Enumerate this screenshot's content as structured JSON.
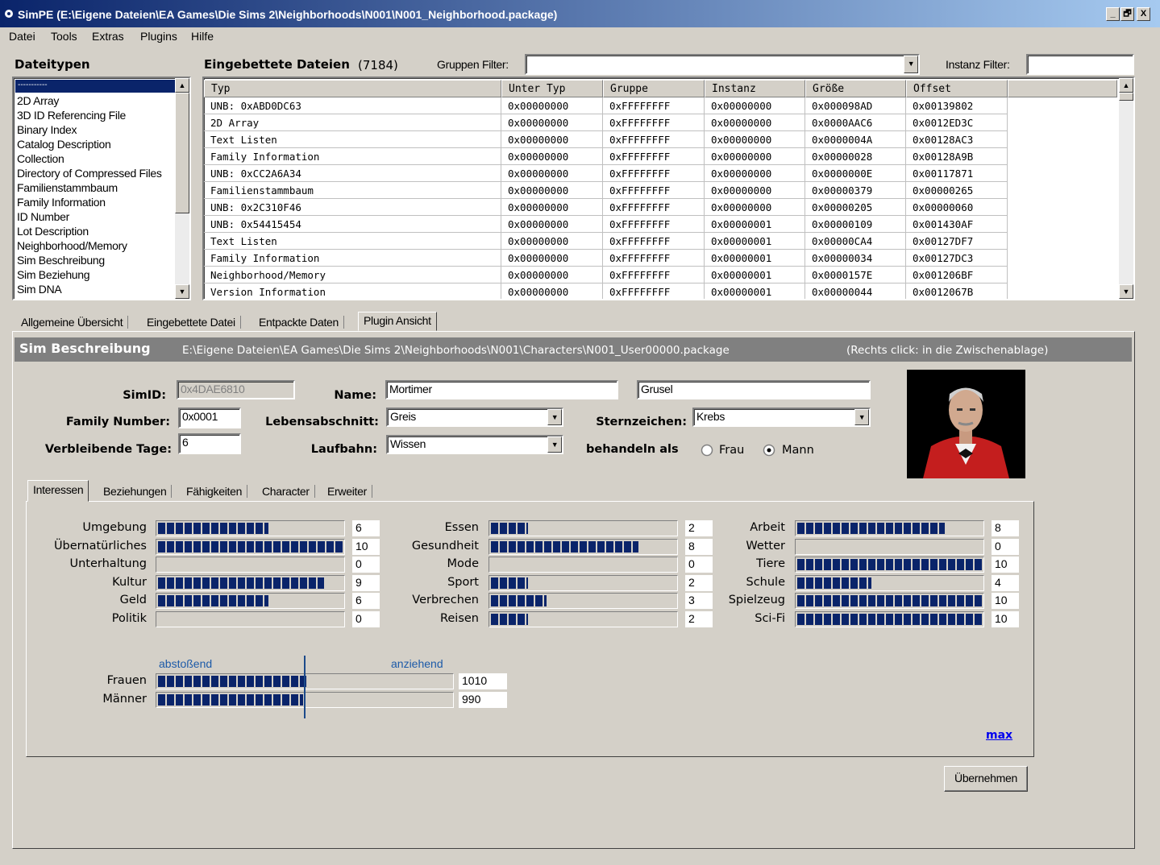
{
  "window": {
    "title": "SimPE (E:\\Eigene Dateien\\EA Games\\Die Sims 2\\Neighborhoods\\N001\\N001_Neighborhood.package)",
    "buttons": [
      "_",
      "🗗",
      "X"
    ]
  },
  "menu": [
    "Datei",
    "Tools",
    "Extras",
    "Plugins",
    "Hilfe"
  ],
  "filetypes": {
    "header": "Dateitypen",
    "selected": "-----------",
    "items": [
      "2D Array",
      "3D ID Referencing File",
      "Binary Index",
      "Catalog Description",
      "Collection",
      "Directory of Compressed Files",
      "Familienstammbaum",
      "Family Information",
      "ID Number",
      "Lot Description",
      "Neighborhood/Memory",
      "Sim Beschreibung",
      "Sim Beziehung",
      "Sim DNA"
    ]
  },
  "embedded": {
    "header": "Eingebettete Dateien",
    "count": "(7184)",
    "group_filter_label": "Gruppen Filter:",
    "group_filter_value": "",
    "instance_filter_label": "Instanz Filter:",
    "instance_filter_value": "",
    "columns": [
      "Typ",
      "Unter Typ",
      "Gruppe",
      "Instanz",
      "Größe",
      "Offset"
    ],
    "rows": [
      [
        "UNB: 0xABD0DC63",
        "0x00000000",
        "0xFFFFFFFF",
        "0x00000000",
        "0x000098AD",
        "0x00139802"
      ],
      [
        "2D Array",
        "0x00000000",
        "0xFFFFFFFF",
        "0x00000000",
        "0x0000AAC6",
        "0x0012ED3C"
      ],
      [
        "Text Listen",
        "0x00000000",
        "0xFFFFFFFF",
        "0x00000000",
        "0x0000004A",
        "0x00128AC3"
      ],
      [
        "Family Information",
        "0x00000000",
        "0xFFFFFFFF",
        "0x00000000",
        "0x00000028",
        "0x00128A9B"
      ],
      [
        "UNB: 0xCC2A6A34",
        "0x00000000",
        "0xFFFFFFFF",
        "0x00000000",
        "0x0000000E",
        "0x00117871"
      ],
      [
        "Familienstammbaum",
        "0x00000000",
        "0xFFFFFFFF",
        "0x00000000",
        "0x00000379",
        "0x00000265"
      ],
      [
        "UNB: 0x2C310F46",
        "0x00000000",
        "0xFFFFFFFF",
        "0x00000000",
        "0x00000205",
        "0x00000060"
      ],
      [
        "UNB: 0x54415454",
        "0x00000000",
        "0xFFFFFFFF",
        "0x00000001",
        "0x00000109",
        "0x001430AF"
      ],
      [
        "Text Listen",
        "0x00000000",
        "0xFFFFFFFF",
        "0x00000001",
        "0x00000CA4",
        "0x00127DF7"
      ],
      [
        "Family Information",
        "0x00000000",
        "0xFFFFFFFF",
        "0x00000001",
        "0x00000034",
        "0x00127DC3"
      ],
      [
        "Neighborhood/Memory",
        "0x00000000",
        "0xFFFFFFFF",
        "0x00000001",
        "0x0000157E",
        "0x001206BF"
      ],
      [
        "Version Information",
        "0x00000000",
        "0xFFFFFFFF",
        "0x00000001",
        "0x00000044",
        "0x0012067B"
      ]
    ]
  },
  "main_tabs": [
    "Allgemeine Übersicht",
    "Eingebettete Datei",
    "Entpackte Daten",
    "Plugin Ansicht"
  ],
  "plugin": {
    "title": "Sim Beschreibung",
    "path": "E:\\Eigene Dateien\\EA Games\\Die Sims 2\\Neighborhoods\\N001\\Characters\\N001_User00000.package",
    "hint": "(Rechts click: in die Zwischenablage)"
  },
  "sim": {
    "simid_label": "SimID:",
    "simid": "0x4DAE6810",
    "name_label": "Name:",
    "first_name": "Mortimer",
    "last_name": "Grusel",
    "family_label": "Family Number:",
    "family_number": "0x0001",
    "life_stage_label": "Lebensabschnitt:",
    "life_stage": "Greis",
    "zodiac_label": "Sternzeichen:",
    "zodiac": "Krebs",
    "days_label": "Verbleibende Tage:",
    "days": "6",
    "career_label": "Laufbahn:",
    "career": "Wissen",
    "treat_label": "behandeln als",
    "gender_female": "Frau",
    "gender_male": "Mann",
    "gender_selected": "Mann"
  },
  "sub_tabs": [
    "Interessen",
    "Beziehungen",
    "Fähigkeiten",
    "Character",
    "Erweiter"
  ],
  "interests": [
    [
      {
        "label": "Umgebung",
        "value": "6"
      },
      {
        "label": "Übernatürliches",
        "value": "10"
      },
      {
        "label": "Unterhaltung",
        "value": "0"
      },
      {
        "label": "Kultur",
        "value": "9"
      },
      {
        "label": "Geld",
        "value": "6"
      },
      {
        "label": "Politik",
        "value": "0"
      }
    ],
    [
      {
        "label": "Essen",
        "value": "2"
      },
      {
        "label": "Gesundheit",
        "value": "8"
      },
      {
        "label": "Mode",
        "value": "0"
      },
      {
        "label": "Sport",
        "value": "2"
      },
      {
        "label": "Verbrechen",
        "value": "3"
      },
      {
        "label": "Reisen",
        "value": "2"
      }
    ],
    [
      {
        "label": "Arbeit",
        "value": "8"
      },
      {
        "label": "Wetter",
        "value": "0"
      },
      {
        "label": "Tiere",
        "value": "10"
      },
      {
        "label": "Schule",
        "value": "4"
      },
      {
        "label": "Spielzeug",
        "value": "10"
      },
      {
        "label": "Sci-Fi",
        "value": "10"
      }
    ]
  ],
  "attraction": {
    "left_label": "abstoßend",
    "right_label": "anziehend",
    "rows": [
      {
        "label": "Frauen",
        "value": "1010",
        "fraction": 0.505
      },
      {
        "label": "Männer",
        "value": "990",
        "fraction": 0.495
      }
    ]
  },
  "max_link": "max",
  "apply_button": "Übernehmen",
  "colors": {
    "bar": "#0a246a",
    "title_bar": "#0a246a",
    "section_header": "#808080",
    "face": "#d4d0c8"
  }
}
